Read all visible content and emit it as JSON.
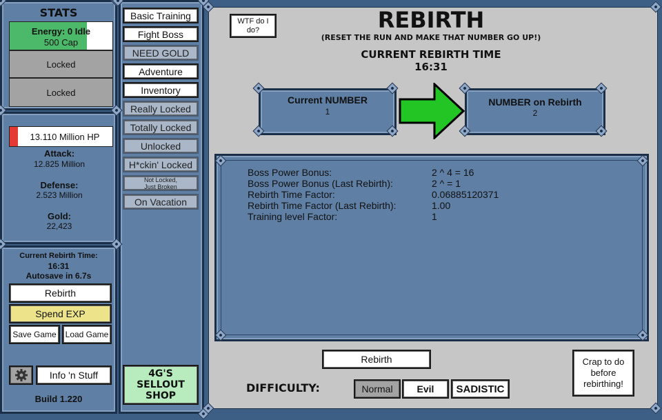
{
  "stats": {
    "title": "STATS",
    "energy_line1": "Energy: 0 Idle",
    "energy_line2": "500 Cap",
    "energy_fill_fraction": 0.75,
    "locked_1": "Locked",
    "locked_2": "Locked",
    "hp": "13.110 Million HP",
    "hp_fill_fraction": 0.08,
    "attack_label": "Attack:",
    "attack_value": "12.825 Million",
    "defense_label": "Defense:",
    "defense_value": "2.523 Million",
    "gold_label": "Gold:",
    "gold_value": "22,423",
    "colors": {
      "energy": "#4cb86a",
      "hp": "#e53935",
      "spend_exp": "#ece38a",
      "shop": "#b8ebbd",
      "arrow": "#22c524"
    }
  },
  "rebirth_info": {
    "label": "Current Rebirth Time:",
    "time": "16:31",
    "autosave": "Autosave in 6.7s",
    "rebirth_btn": "Rebirth",
    "spend_exp_btn": "Spend EXP",
    "save_btn": "Save Game",
    "load_btn": "Load Game",
    "settings_icon": "gear-icon",
    "info_btn": "Info 'n Stuff",
    "build": "Build 1.220"
  },
  "nav": {
    "basic_training": "Basic Training",
    "fight_boss": "Fight Boss",
    "need_gold": "NEED GOLD",
    "adventure": "Adventure",
    "inventory": "Inventory",
    "really_locked": "Really Locked",
    "totally_locked": "Totally Locked",
    "unlocked": "Unlocked",
    "heckin_locked": "H*ckin' Locked",
    "not_locked_1": "Not Locked,",
    "not_locked_2": "Just Broken",
    "on_vacation": "On Vacation",
    "shop_1": "4G'S",
    "shop_2": "SELLOUT",
    "shop_3": "SHOP"
  },
  "main": {
    "wtf_1": "WTF do I",
    "wtf_2": "do?",
    "title": "REBIRTH",
    "subtitle": "(RESET THE RUN AND MAKE THAT NUMBER GO UP!)",
    "current_time_label": "CURRENT REBIRTH TIME",
    "current_time": "16:31",
    "current_number_label": "Current NUMBER",
    "current_number": "1",
    "rebirth_number_label": "NUMBER on Rebirth",
    "rebirth_number": "2",
    "rows": [
      {
        "label": "Boss Power Bonus:",
        "value": "2 ^ 4 = 16"
      },
      {
        "label": "Boss Power Bonus (Last Rebirth):",
        "value": "2 ^  = 1"
      },
      {
        "label": "Rebirth Time Factor:",
        "value": "0.06885120371"
      },
      {
        "label": "Rebirth Time Factor (Last Rebirth):",
        "value": "1.00"
      },
      {
        "label": "Training level Factor:",
        "value": "1"
      }
    ],
    "rebirth_btn": "Rebirth",
    "crap_1": "Crap to do",
    "crap_2": "before",
    "crap_3": "rebirthing!",
    "difficulty_label": "DIFFICULTY:",
    "diff_normal": "Normal",
    "diff_evil": "Evil",
    "diff_sadistic": "SADISTIC"
  }
}
